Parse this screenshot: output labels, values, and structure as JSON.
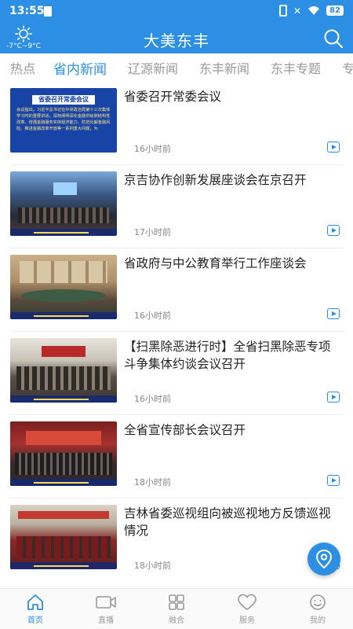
{
  "status_bar": {
    "time": "13:55",
    "battery": "82"
  },
  "header": {
    "title": "大美东丰",
    "temperature": "-7°C~9°C"
  },
  "tabs": [
    {
      "label": "热点"
    },
    {
      "label": "省内新闻"
    },
    {
      "label": "辽源新闻"
    },
    {
      "label": "东丰新闻"
    },
    {
      "label": "东丰专题"
    },
    {
      "label": "专"
    }
  ],
  "news": [
    {
      "headline": "省委召开常委会议",
      "time": "16小时前",
      "thumb_title": "省委召开常委会议",
      "thumb_text": "会议指出，习近平总书记在中央政治局第十三次集体学习时的重要讲话，深刻阐明深化金融供给侧结构性改革、增强金融服务实体经济能力、防范化解金融风险、推进金融改革开放等一系列重大问题，为"
    },
    {
      "headline": "京吉协作创新发展座谈会在京召开",
      "time": "17小时前"
    },
    {
      "headline": "省政府与中公教育举行工作座谈会",
      "time": "16小时前"
    },
    {
      "headline": "【扫黑除恶进行时】全省扫黑除恶专项斗争集体约谈会议召开",
      "time": "16小时前"
    },
    {
      "headline": "全省宣传部长会议召开",
      "time": "18小时前"
    },
    {
      "headline": "吉林省委巡视组向被巡视地方反馈巡视情况",
      "time": "18小时前"
    }
  ],
  "bottom_nav": [
    {
      "label": "首页"
    },
    {
      "label": "直播"
    },
    {
      "label": "融合"
    },
    {
      "label": "服务"
    },
    {
      "label": "我的"
    }
  ],
  "colors": {
    "accent": "#2c8fe4"
  }
}
